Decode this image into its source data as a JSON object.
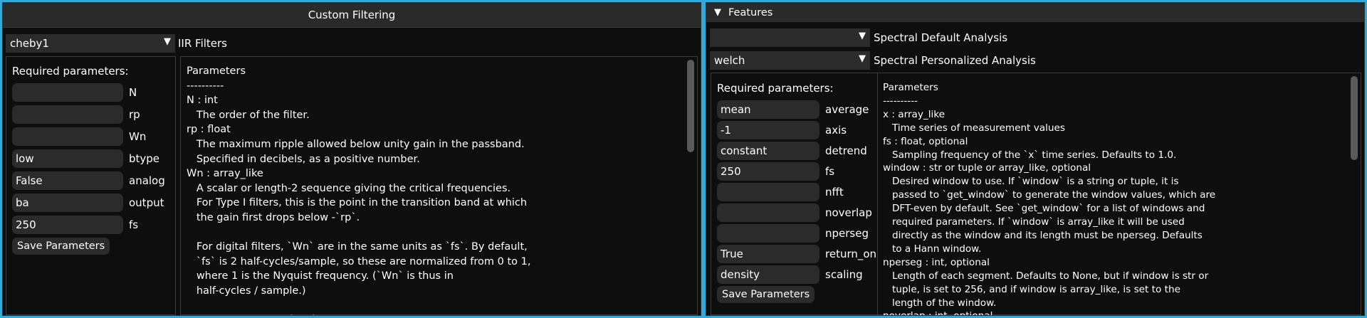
{
  "left": {
    "title": "Custom Filtering",
    "filter_select": {
      "value": "cheby1",
      "label": "IIR Filters"
    },
    "required_title": "Required parameters:",
    "params": [
      {
        "value": "",
        "label": "N"
      },
      {
        "value": "",
        "label": "rp"
      },
      {
        "value": "",
        "label": "Wn"
      },
      {
        "value": "low",
        "label": "btype"
      },
      {
        "value": "False",
        "label": "analog"
      },
      {
        "value": "ba",
        "label": "output"
      },
      {
        "value": "250",
        "label": "fs"
      }
    ],
    "save_label": "Save Parameters",
    "doc_text": "Parameters\n----------\nN : int\n   The order of the filter.\nrp : float\n   The maximum ripple allowed below unity gain in the passband.\n   Specified in decibels, as a positive number.\nWn : array_like\n   A scalar or length-2 sequence giving the critical frequencies.\n   For Type I filters, this is the point in the transition band at which\n   the gain first drops below -`rp`.\n\n   For digital filters, `Wn` are in the same units as `fs`. By default,\n   `fs` is 2 half-cycles/sample, so these are normalized from 0 to 1,\n   where 1 is the Nyquist frequency. (`Wn` is thus in\n   half-cycles / sample.)\n\n   For analog filters, `Wn` is an angular frequency (e.g., rad/s)."
  },
  "right": {
    "features_label": "Features",
    "default_select": {
      "value": "",
      "label": "Spectral Default Analysis"
    },
    "personal_select": {
      "value": "welch",
      "label": "Spectral Personalized Analysis"
    },
    "required_title": "Required parameters:",
    "params": [
      {
        "value": "mean",
        "label": "average"
      },
      {
        "value": "-1",
        "label": "axis"
      },
      {
        "value": "constant",
        "label": "detrend"
      },
      {
        "value": "250",
        "label": "fs"
      },
      {
        "value": "",
        "label": "nfft"
      },
      {
        "value": "",
        "label": "noverlap"
      },
      {
        "value": "",
        "label": "nperseg"
      },
      {
        "value": "True",
        "label": "return_on"
      },
      {
        "value": "density",
        "label": "scaling"
      }
    ],
    "save_label": "Save Parameters",
    "doc_text": "Parameters\n----------\nx : array_like\n   Time series of measurement values\nfs : float, optional\n   Sampling frequency of the `x` time series. Defaults to 1.0.\nwindow : str or tuple or array_like, optional\n   Desired window to use. If `window` is a string or tuple, it is\n   passed to `get_window` to generate the window values, which are\n   DFT-even by default. See `get_window` for a list of windows and\n   required parameters. If `window` is array_like it will be used\n   directly as the window and its length must be nperseg. Defaults\n   to a Hann window.\nnperseg : int, optional\n   Length of each segment. Defaults to None, but if window is str or\n   tuple, is set to 256, and if window is array_like, is set to the\n   length of the window.\nnoverlap : int, optional"
  },
  "icons": {
    "dropdown_arrow": "triangle-down",
    "collapse_arrow": "triangle-down"
  },
  "colors": {
    "accent_border": "#33a9d8",
    "window_bg": "#0e0e0e",
    "widget_bg": "#2b2b2b"
  }
}
